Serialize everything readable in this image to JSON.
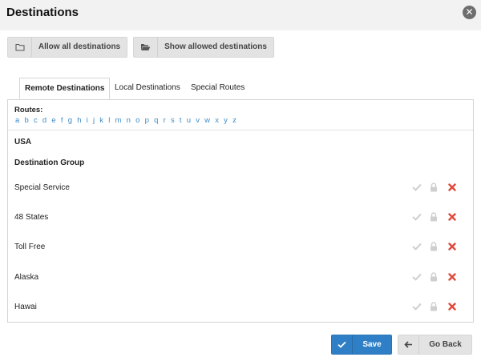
{
  "dialog": {
    "title": "Destinations",
    "close_icon": "close-circle-icon"
  },
  "toolbar": {
    "allow_label": "Allow all destinations",
    "allow_icon": "folder-outline-icon",
    "show_label": "Show allowed destinations",
    "show_icon": "folder-open-icon"
  },
  "tabs": [
    {
      "label": "Remote Destinations",
      "active": true
    },
    {
      "label": "Local Destinations",
      "active": false
    },
    {
      "label": "Special Routes",
      "active": false
    }
  ],
  "routes": {
    "label": "Routes:",
    "letters": [
      "a",
      "b",
      "c",
      "d",
      "e",
      "f",
      "g",
      "h",
      "i",
      "j",
      "k",
      "l",
      "m",
      "n",
      "o",
      "p",
      "q",
      "r",
      "s",
      "t",
      "u",
      "v",
      "w",
      "x",
      "y",
      "z"
    ]
  },
  "country": "USA",
  "group_header": "Destination Group",
  "groups": [
    {
      "name": "Special Service"
    },
    {
      "name": "48 States"
    },
    {
      "name": "Toll Free"
    },
    {
      "name": "Alaska"
    },
    {
      "name": "Hawai"
    }
  ],
  "row_icons": {
    "check": "check-icon",
    "lock": "lock-icon",
    "delete": "x-delete-icon"
  },
  "colors": {
    "link": "#3a8cc9",
    "primary": "#2f7fc6",
    "delete": "#e04a3a",
    "muted_icon": "#cfcfcf"
  },
  "footer": {
    "save_label": "Save",
    "back_label": "Go Back"
  }
}
